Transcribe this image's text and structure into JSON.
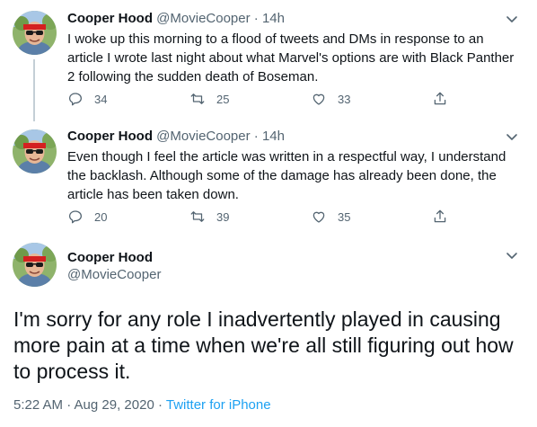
{
  "tweets": [
    {
      "name": "Cooper Hood",
      "handle": "@MovieCooper",
      "time": "14h",
      "text": "I woke up this morning to a flood of tweets and DMs in response to an article I wrote last night about what Marvel's options are with Black Panther 2 following the sudden death of Boseman.",
      "replies": "34",
      "retweets": "25",
      "likes": "33"
    },
    {
      "name": "Cooper Hood",
      "handle": "@MovieCooper",
      "time": "14h",
      "text": "Even though I feel the article was written in a respectful way, I understand the backlash. Although some of the damage has already been done, the article has been taken down.",
      "replies": "20",
      "retweets": "39",
      "likes": "35"
    }
  ],
  "main_tweet": {
    "name": "Cooper Hood",
    "handle": "@MovieCooper",
    "text": "I'm sorry for any role I inadvertently played in causing more pain at a time when we're all still figuring out how to process it.",
    "timestamp": "5:22 AM · Aug 29, 2020",
    "separator": " · ",
    "source": "Twitter for iPhone"
  },
  "ui": {
    "dot": "·",
    "accent_color": "#1da1f2",
    "secondary_text_color": "#536471"
  }
}
